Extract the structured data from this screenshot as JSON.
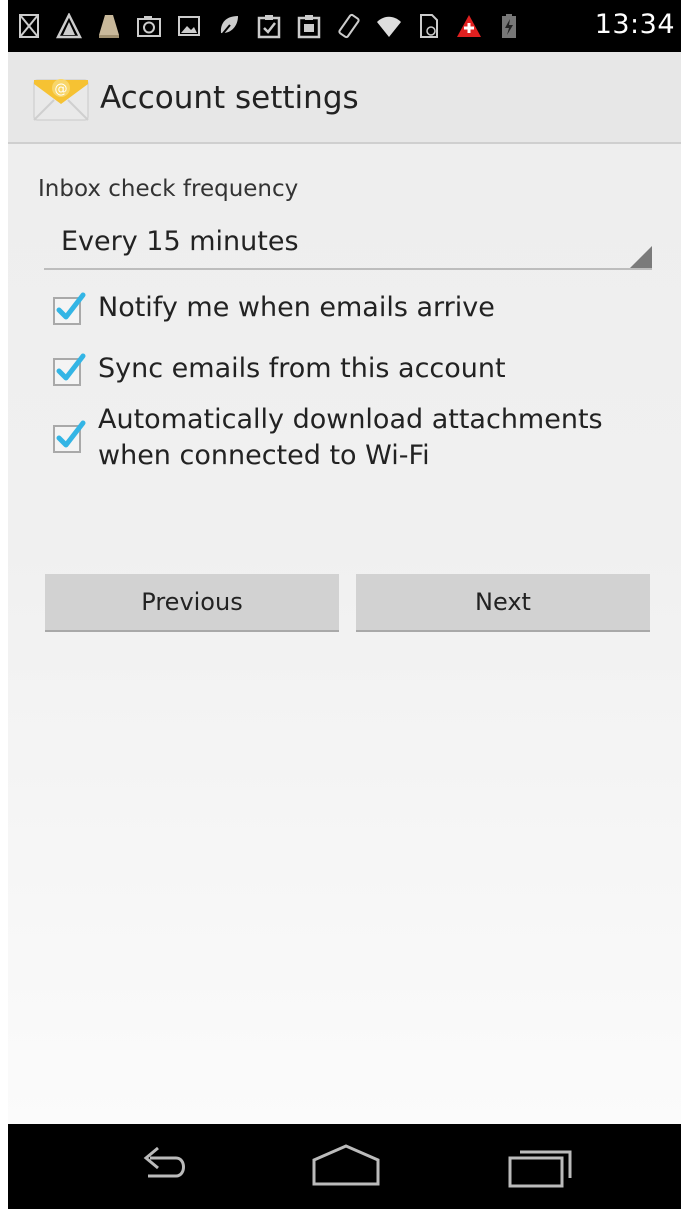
{
  "status_bar": {
    "time": "13:34",
    "icons": [
      "sleep-hourglass-icon",
      "adt-icon",
      "lamp-icon",
      "camera-icon",
      "image-icon",
      "leaf-icon",
      "clipboard-check-icon",
      "clipboard-upload-icon",
      "phone-rotate-icon",
      "wifi-icon",
      "sim-icon",
      "alert-icon",
      "battery-charging-icon"
    ],
    "alert_color": "#e02020"
  },
  "action_bar": {
    "title": "Account settings",
    "icon": "email-app-icon"
  },
  "form": {
    "frequency_label": "Inbox check frequency",
    "frequency_value": "Every 15 minutes",
    "checkboxes": [
      {
        "label": "Notify me when emails arrive",
        "checked": true
      },
      {
        "label": "Sync emails from this account",
        "checked": true
      },
      {
        "label": "Automatically download attachments when connected to Wi-Fi",
        "checked": true
      }
    ]
  },
  "buttons": {
    "previous": "Previous",
    "next": "Next"
  },
  "nav_bar": {
    "icons": [
      "back-icon",
      "home-icon",
      "recents-icon"
    ]
  },
  "colors": {
    "check_accent": "#33b5e5",
    "action_bar_bg": "#e7e7e7",
    "button_bg": "#d2d2d2"
  }
}
